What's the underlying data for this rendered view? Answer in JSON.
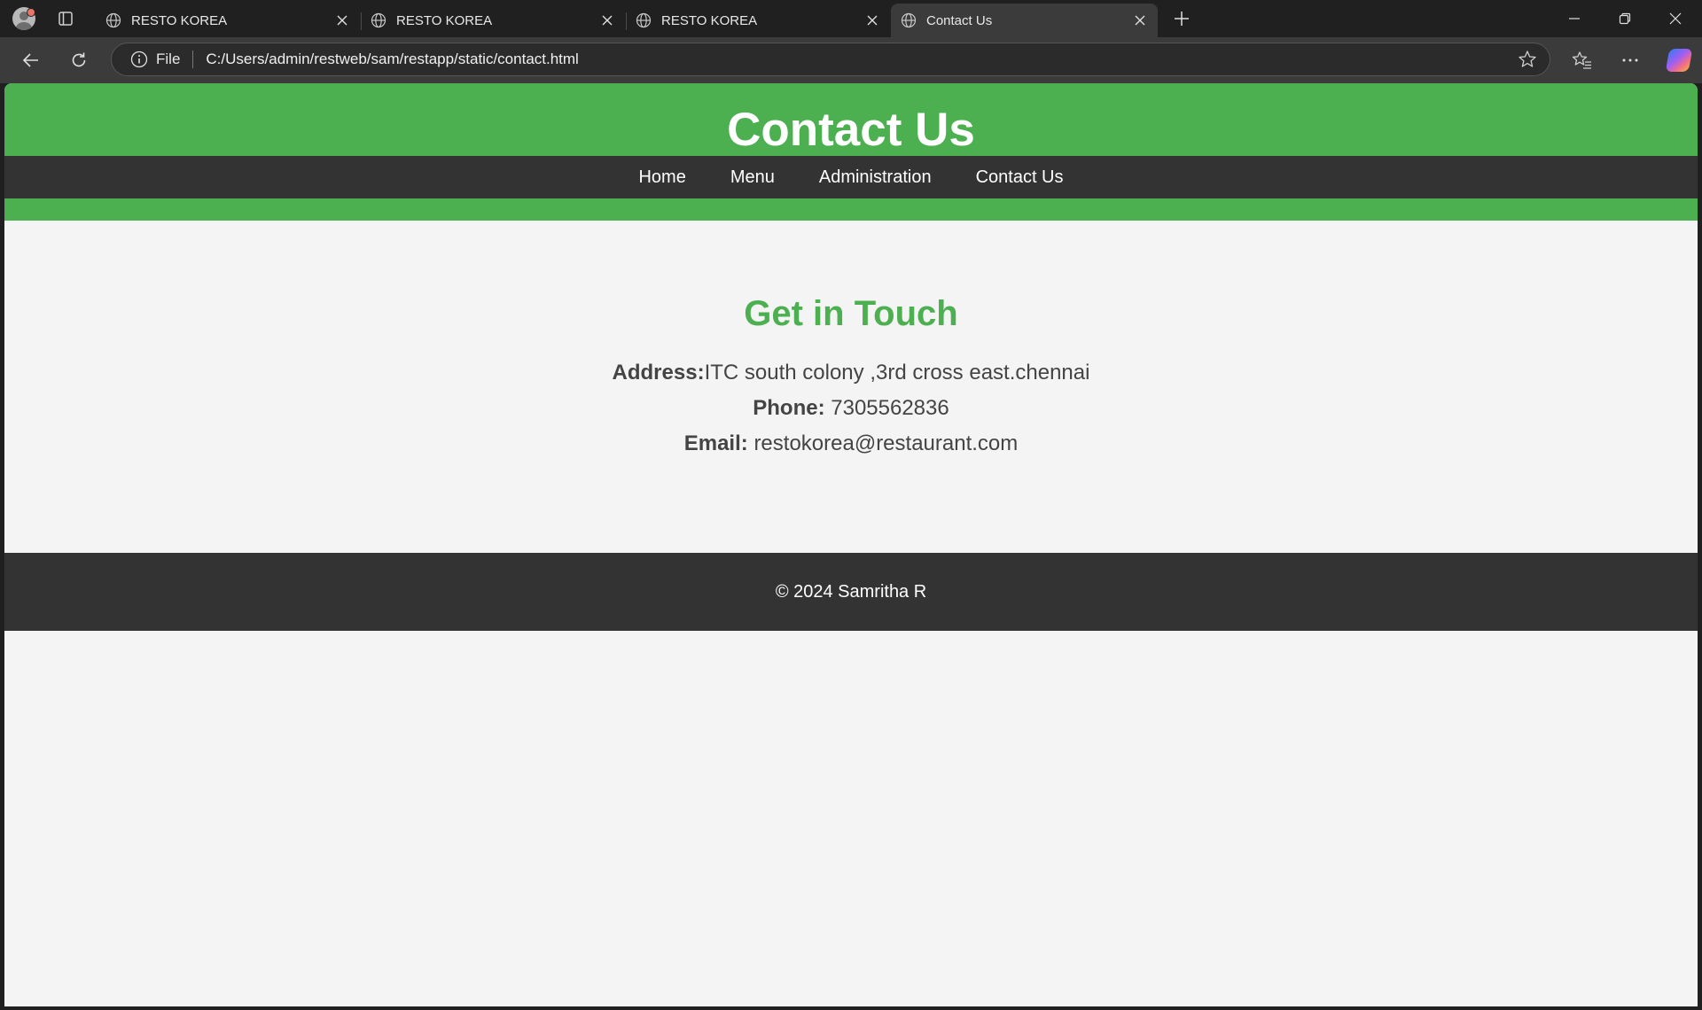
{
  "browser": {
    "tabs": [
      {
        "title": "RESTO KOREA",
        "active": false
      },
      {
        "title": "RESTO KOREA",
        "active": false
      },
      {
        "title": "RESTO KOREA",
        "active": false
      },
      {
        "title": "Contact Us",
        "active": true
      }
    ],
    "address": {
      "scheme": "File",
      "url": "C:/Users/admin/restweb/sam/restapp/static/contact.html"
    },
    "icons": [
      "profile-avatar",
      "tab-actions-icon",
      "globe-icon",
      "close-icon",
      "new-tab-icon",
      "minimize-icon",
      "restore-icon",
      "window-close-icon",
      "back-icon",
      "reload-icon",
      "info-icon",
      "star-icon",
      "favorites-icon",
      "more-icon",
      "copilot-icon"
    ]
  },
  "page": {
    "header": {
      "title": "Contact Us"
    },
    "nav": {
      "items": [
        {
          "label": "Home"
        },
        {
          "label": "Menu"
        },
        {
          "label": "Administration"
        },
        {
          "label": "Contact Us"
        }
      ]
    },
    "contact": {
      "heading": "Get in Touch",
      "address_label": "Address:",
      "address_value": "ITC south colony ,3rd cross east.chennai",
      "phone_label": "Phone:",
      "phone_value": "7305562836",
      "email_label": "Email:",
      "email_value": "restokorea@restaurant.com"
    },
    "footer": {
      "text": "© 2024 Samritha R"
    }
  },
  "colors": {
    "brand_green": "#4caf50",
    "dark_bar": "#333333",
    "page_bg": "#f4f4f4",
    "text": "#444444"
  }
}
